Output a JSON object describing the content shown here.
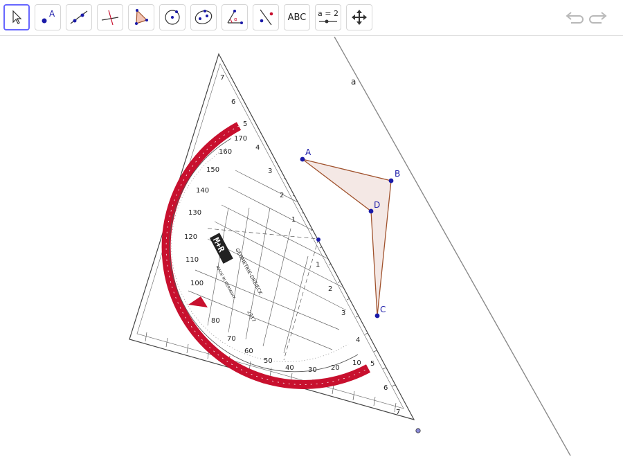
{
  "toolbar": {
    "tools": [
      {
        "name": "move-tool",
        "icon": "arrow-pointer-icon"
      },
      {
        "name": "point-tool",
        "icon": "point-icon",
        "label": "A"
      },
      {
        "name": "line-tool",
        "icon": "line-through-points-icon"
      },
      {
        "name": "perpendicular-line-tool",
        "icon": "perpendicular-icon"
      },
      {
        "name": "polygon-tool",
        "icon": "polygon-icon"
      },
      {
        "name": "circle-tool",
        "icon": "circle-center-point-icon"
      },
      {
        "name": "ellipse-tool",
        "icon": "ellipse-icon"
      },
      {
        "name": "angle-tool",
        "icon": "angle-icon"
      },
      {
        "name": "reflect-tool",
        "icon": "reflect-about-line-icon"
      },
      {
        "name": "text-tool",
        "icon": "text-icon",
        "label": "ABC"
      },
      {
        "name": "slider-tool",
        "icon": "slider-icon",
        "label": "a = 2"
      },
      {
        "name": "move-graphics-view-tool",
        "icon": "move-arrows-icon"
      }
    ],
    "undo_icon": "undo-icon",
    "redo_icon": "redo-icon"
  },
  "canvas": {
    "line_label": "a",
    "points": [
      {
        "label": "A"
      },
      {
        "label": "B"
      },
      {
        "label": "D"
      },
      {
        "label": "C"
      }
    ],
    "protractor_brand": "M+R",
    "protractor_text": "GEOMETRIE-DREIECK",
    "protractor_made_in": "MADE IN GERMANY",
    "protractor_model": "2317",
    "colors": {
      "accent": "#6666ff",
      "polygon_fill": "#f2e4e0",
      "polygon_stroke": "#a0522d",
      "point": "#1a1aa8",
      "protractor_red": "#c8102e"
    }
  }
}
